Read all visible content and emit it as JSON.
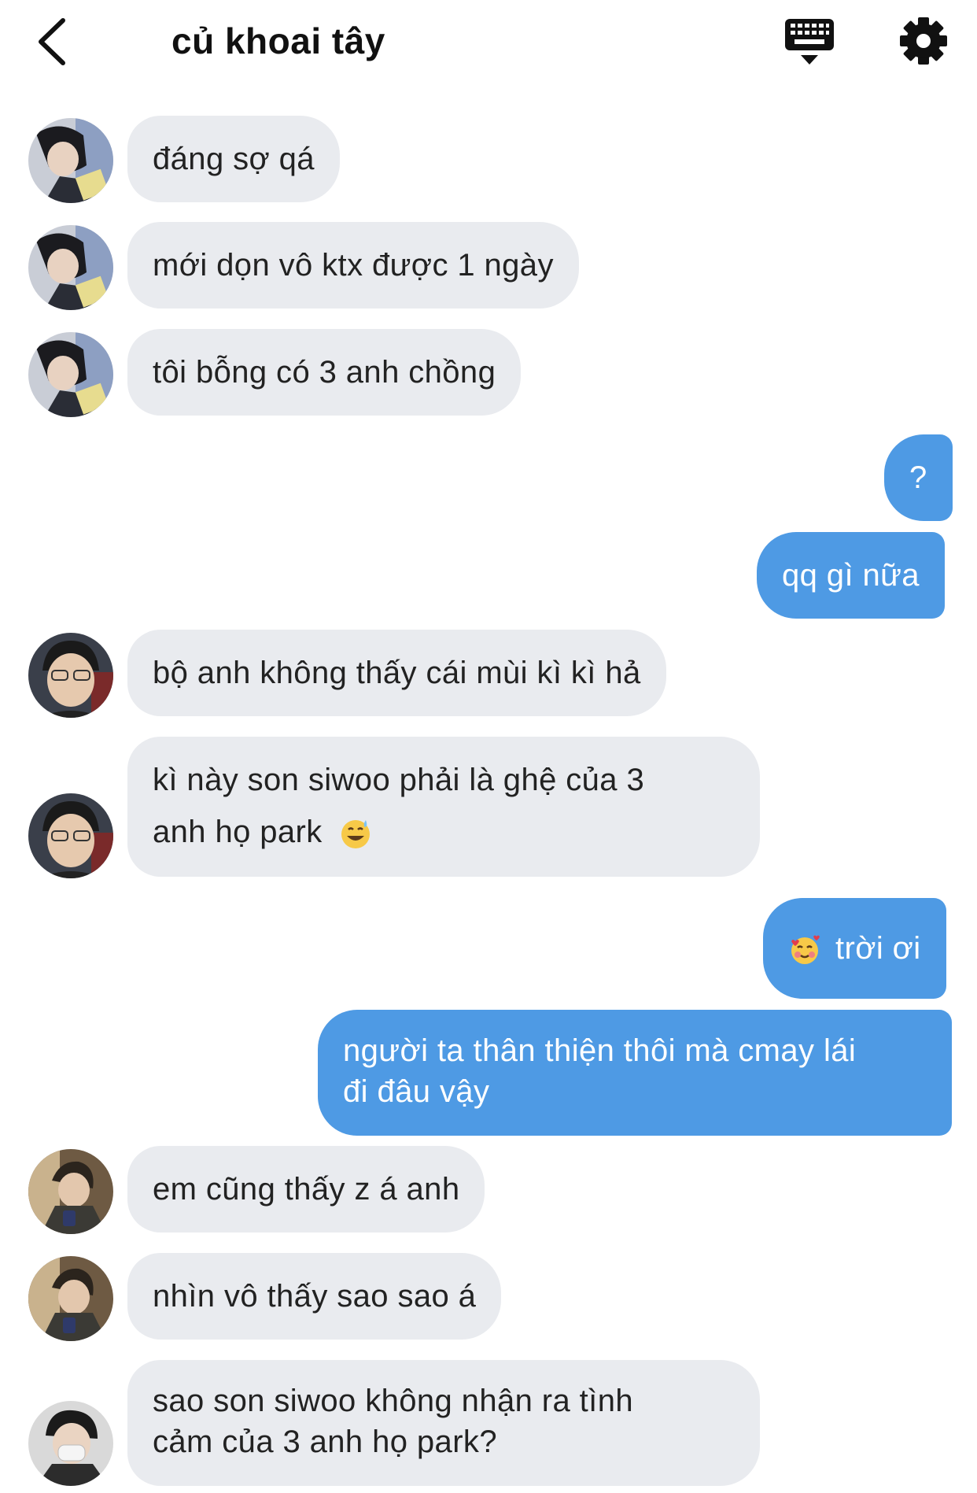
{
  "header": {
    "title": "củ khoai tây",
    "back_icon": "chevron-left-icon",
    "keyboard_icon": "keyboard-icon",
    "settings_icon": "gear-icon"
  },
  "colors": {
    "incoming_bubble": "#e9ebef",
    "outgoing_bubble": "#4e9ae4",
    "incoming_text": "#222222",
    "outgoing_text": "#ffffff"
  },
  "messages": [
    {
      "side": "incoming",
      "sender_avatar": "avatar-a",
      "lines": [
        "đáng sợ qá"
      ]
    },
    {
      "side": "incoming",
      "sender_avatar": "avatar-a",
      "lines": [
        "mới dọn vô ktx được 1 ngày"
      ]
    },
    {
      "side": "incoming",
      "sender_avatar": "avatar-a",
      "lines": [
        "tôi bỗng có 3 anh chồng"
      ]
    },
    {
      "side": "outgoing",
      "lines": [
        "?"
      ]
    },
    {
      "side": "outgoing",
      "lines": [
        "qq gì nữa"
      ]
    },
    {
      "side": "incoming",
      "sender_avatar": "avatar-b",
      "lines": [
        "bộ anh không thấy cái mùi kì kì hả"
      ]
    },
    {
      "side": "incoming",
      "sender_avatar": "avatar-b",
      "lines": [
        "kì này son siwoo phải là ghệ của 3",
        "anh họ park"
      ],
      "trailing_emoji": "grinning-sweat-emoji"
    },
    {
      "side": "outgoing",
      "leading_emoji": "smiling-hearts-emoji",
      "lines": [
        "trời ơi"
      ]
    },
    {
      "side": "outgoing",
      "lines": [
        "người ta thân thiện thôi mà cmay lái",
        "đi đâu vậy"
      ]
    },
    {
      "side": "incoming",
      "sender_avatar": "avatar-c",
      "lines": [
        "em cũng thấy z á anh"
      ]
    },
    {
      "side": "incoming",
      "sender_avatar": "avatar-c",
      "lines": [
        "nhìn vô thấy sao sao á"
      ]
    },
    {
      "side": "incoming",
      "sender_avatar": "avatar-d",
      "lines": [
        "sao son siwoo không nhận ra tình",
        "cảm của 3 anh họ park?"
      ]
    }
  ]
}
